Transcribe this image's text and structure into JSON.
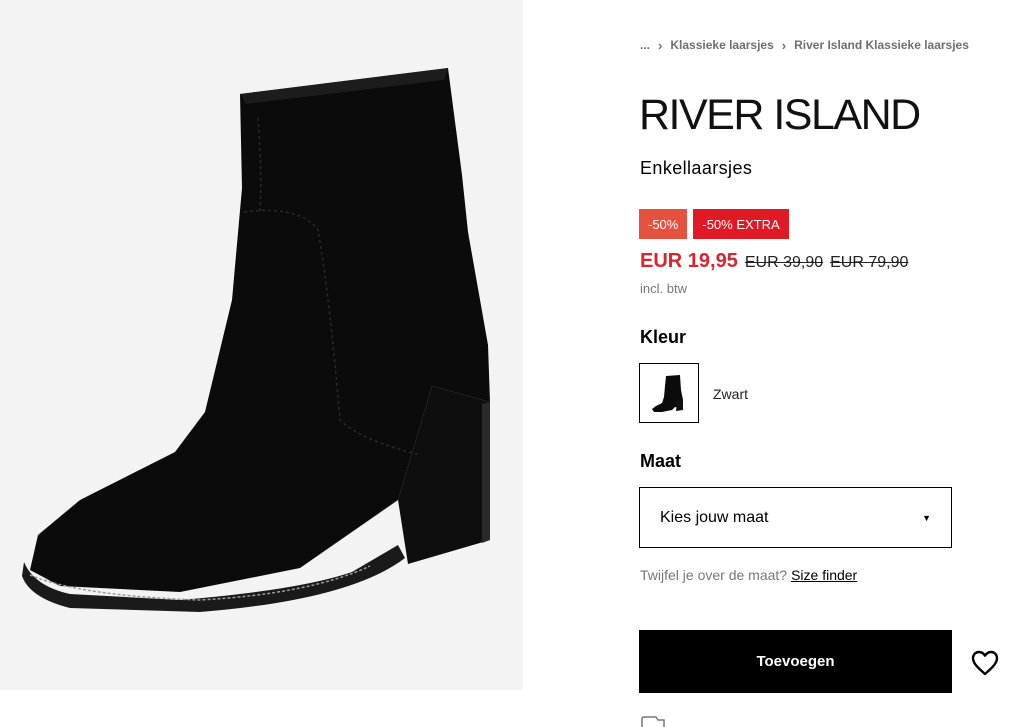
{
  "breadcrumb": {
    "ellipsis": "...",
    "items": [
      "Klassieke laarsjes",
      "River Island Klassieke laarsjes"
    ]
  },
  "brand": {
    "name": "RIVER ISLAND"
  },
  "product": {
    "name": "Enkellaarsjes"
  },
  "badges": [
    {
      "label": "-50%",
      "color": "#e4513d"
    },
    {
      "label": "-50% EXTRA",
      "color": "#e01a24"
    }
  ],
  "price": {
    "current": "EUR 19,95",
    "old_1": "EUR 39,90",
    "old_2": "EUR 79,90",
    "vat_note": "incl. btw",
    "current_color": "#d6262e"
  },
  "color_section": {
    "heading": "Kleur",
    "selected_label": "Zwart"
  },
  "size_section": {
    "heading": "Maat",
    "placeholder": "Kies jouw maat",
    "doubt_text": "Twijfel je over de maat?",
    "size_finder_link": "Size finder"
  },
  "actions": {
    "add_to_cart": "Toevoegen",
    "wishlist_icon": "heart-icon"
  }
}
